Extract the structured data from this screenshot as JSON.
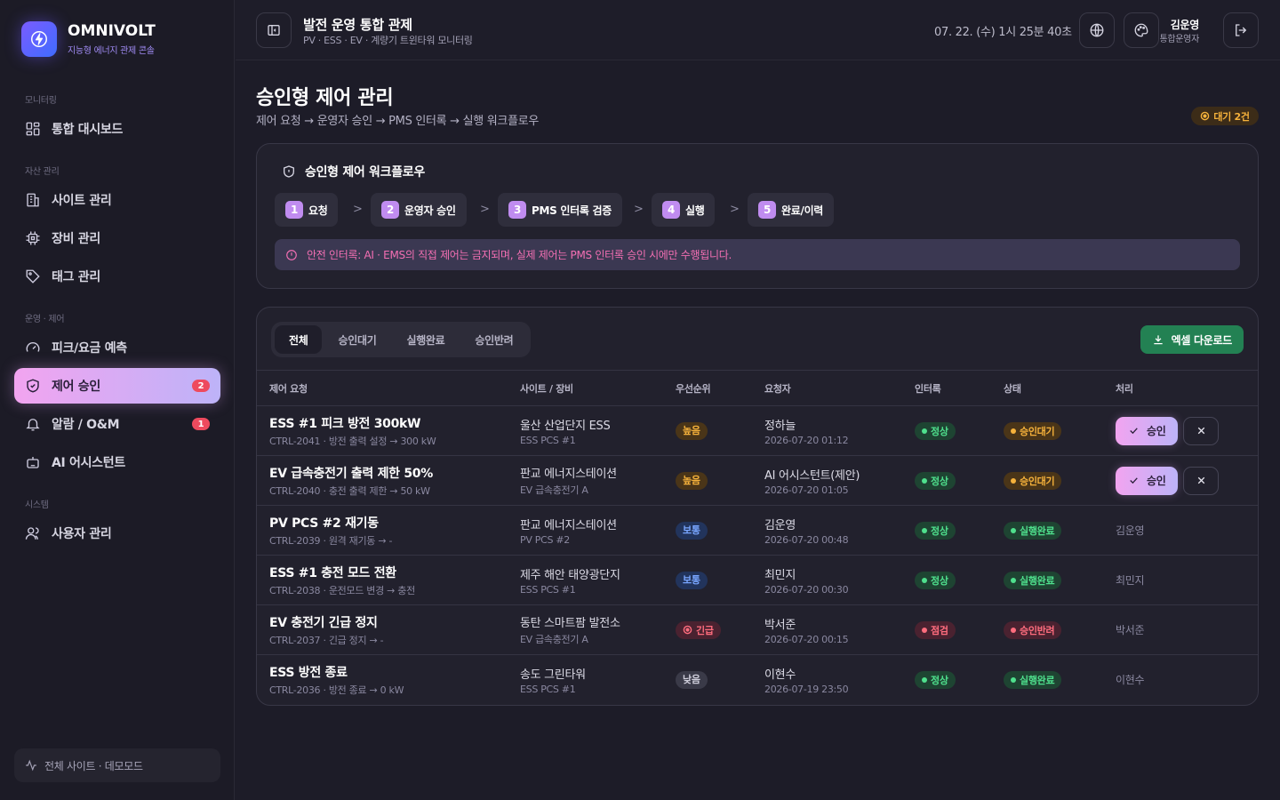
{
  "brand": {
    "name": "OMNIVOLT",
    "subtitle": "지능형 에너지 관제 콘솔"
  },
  "nav": {
    "groups": [
      "모니터링",
      "자산 관리",
      "운영 · 제어",
      "시스템"
    ],
    "items": [
      {
        "label": "통합 대시보드"
      },
      {
        "label": "사이트 관리"
      },
      {
        "label": "장비 관리"
      },
      {
        "label": "태그 관리"
      },
      {
        "label": "피크/요금 예측"
      },
      {
        "label": "제어 승인",
        "badge": "2"
      },
      {
        "label": "알람 / O&M",
        "badge": "1"
      },
      {
        "label": "AI 어시스턴트"
      },
      {
        "label": "사용자 관리"
      }
    ],
    "footer": "전체 사이트 · 데모모드"
  },
  "header": {
    "title": "발전 운영 통합 관제",
    "subtitle": "PV · ESS · EV · 계량기 트윈타워 모니터링",
    "clock": "07. 22. (수) 1시 25분 40초",
    "user_name": "김운영",
    "user_role": "통합운영자"
  },
  "page": {
    "title": "승인형 제어 관리",
    "subtitle": "제어 요청 → 운영자 승인 → PMS 인터록 → 실행 워크플로우",
    "wait_badge": "대기 2건"
  },
  "workflow": {
    "title": "승인형 제어 워크플로우",
    "steps": [
      {
        "num": "1",
        "label": "요청"
      },
      {
        "num": "2",
        "label": "운영자 승인"
      },
      {
        "num": "3",
        "label": "PMS 인터록 검증"
      },
      {
        "num": "4",
        "label": "실행"
      },
      {
        "num": "5",
        "label": "완료/이력"
      }
    ],
    "warning": "안전 인터록: AI · EMS의 직접 제어는 금지되며, 실제 제어는 PMS 인터록 승인 시에만 수행됩니다."
  },
  "table": {
    "tabs": [
      "전체",
      "승인대기",
      "실행완료",
      "승인반려"
    ],
    "excel_label": "엑셀 다운로드",
    "columns": [
      "제어 요청",
      "사이트 / 장비",
      "우선순위",
      "요청자",
      "인터록",
      "상태",
      "처리"
    ],
    "approve_label": "승인",
    "rows": [
      {
        "title": "ESS #1 피크 방전 300kW",
        "desc": "CTRL-2041 · 방전 출력 설정 → 300 kW",
        "site": "울산 산업단지 ESS",
        "device": "ESS PCS #1",
        "priority": "높음",
        "requester": "정하늘",
        "time": "2026-07-20 01:12",
        "interlock": "정상",
        "status": "승인대기",
        "handler": ""
      },
      {
        "title": "EV 급속충전기 출력 제한 50%",
        "desc": "CTRL-2040 · 충전 출력 제한 → 50 kW",
        "site": "판교 에너지스테이션",
        "device": "EV 급속충전기 A",
        "priority": "높음",
        "requester": "AI 어시스턴트(제안)",
        "time": "2026-07-20 01:05",
        "interlock": "정상",
        "status": "승인대기",
        "handler": ""
      },
      {
        "title": "PV PCS #2 재기동",
        "desc": "CTRL-2039 · 원격 재기동 → -",
        "site": "판교 에너지스테이션",
        "device": "PV PCS #2",
        "priority": "보통",
        "requester": "김운영",
        "time": "2026-07-20 00:48",
        "interlock": "정상",
        "status": "실행완료",
        "handler": "김운영"
      },
      {
        "title": "ESS #1 충전 모드 전환",
        "desc": "CTRL-2038 · 운전모드 변경 → 충전",
        "site": "제주 해안 태양광단지",
        "device": "ESS PCS #1",
        "priority": "보통",
        "requester": "최민지",
        "time": "2026-07-20 00:30",
        "interlock": "정상",
        "status": "실행완료",
        "handler": "최민지"
      },
      {
        "title": "EV 충전기 긴급 정지",
        "desc": "CTRL-2037 · 긴급 정지 → -",
        "site": "동탄 스마트팜 발전소",
        "device": "EV 급속충전기 A",
        "priority": "긴급",
        "requester": "박서준",
        "time": "2026-07-20 00:15",
        "interlock": "점검",
        "status": "승인반려",
        "handler": "박서준"
      },
      {
        "title": "ESS 방전 종료",
        "desc": "CTRL-2036 · 방전 종료 → 0 kW",
        "site": "송도 그린타워",
        "device": "ESS PCS #1",
        "priority": "낮음",
        "requester": "이현수",
        "time": "2026-07-19 23:50",
        "interlock": "정상",
        "status": "실행완료",
        "handler": "이현수"
      }
    ]
  },
  "colors": {
    "accent": "#f2a4f0",
    "success": "#4fe08d",
    "warning": "#f6b23b",
    "danger": "#ff6d7e",
    "excel": "#238153"
  }
}
